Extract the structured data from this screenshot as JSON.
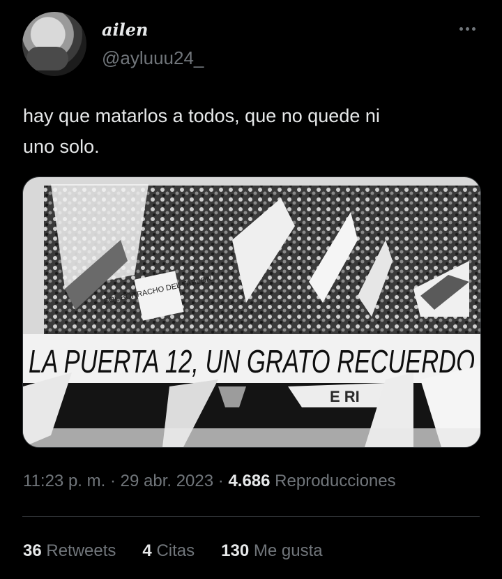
{
  "tweet": {
    "author_name": "ailen",
    "author_handle": "@ayluuu24_",
    "text_line1": "hay que matarlos a todos, que no quede ni",
    "text_line2": "uno solo.",
    "media_banner_text": "LA PUERTA 12, UN GRATO RECUERDO",
    "media_sign_text": "SOL BORRACHO DEL TABLON",
    "media_lower_text": "E   RI",
    "time": "11:23 p. m.",
    "date": "29 abr. 2023",
    "separator": "·",
    "views_count": "4.686",
    "views_label": "Reproducciones"
  },
  "stats": {
    "retweets_count": "36",
    "retweets_label": "Retweets",
    "quotes_count": "4",
    "quotes_label": "Citas",
    "likes_count": "130",
    "likes_label": "Me gusta"
  },
  "icons": {
    "more": "more-horizontal-icon"
  },
  "colors": {
    "background": "#000000",
    "text": "#e7e9ea",
    "secondary": "#71767b",
    "divider": "#2f3336"
  }
}
